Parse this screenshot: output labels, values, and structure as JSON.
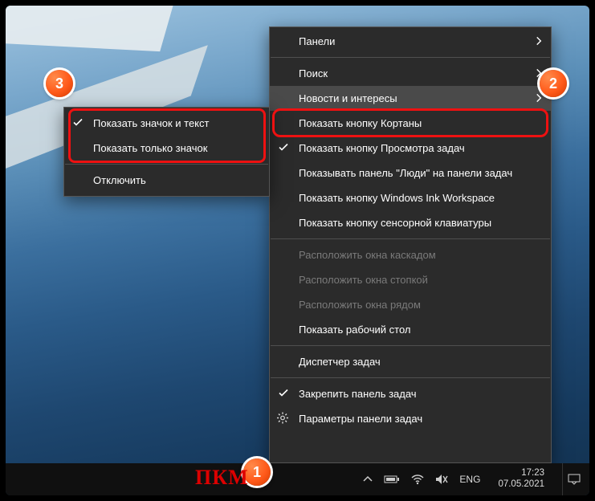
{
  "main_menu": {
    "panels": "Панели",
    "search": "Поиск",
    "news": "Новости и интересы",
    "cortana": "Показать кнопку Кортаны",
    "taskview": "Показать кнопку Просмотра задач",
    "people": "Показывать панель \"Люди\" на панели задач",
    "ink": "Показать кнопку Windows Ink Workspace",
    "touchkb": "Показать кнопку сенсорной клавиатуры",
    "cascade": "Расположить окна каскадом",
    "stack": "Расположить окна стопкой",
    "sidebyside": "Расположить окна рядом",
    "showdesktop": "Показать рабочий стол",
    "taskmgr": "Диспетчер задач",
    "lock": "Закрепить панель задач",
    "settings": "Параметры панели задач"
  },
  "sub_menu": {
    "icon_text": "Показать значок и текст",
    "icon_only": "Показать только значок",
    "off": "Отключить"
  },
  "taskbar": {
    "lang": "ENG",
    "time": "17:23",
    "date": "07.05.2021"
  },
  "annotations": {
    "pkm": "ПКМ",
    "b1": "1",
    "b2": "2",
    "b3": "3"
  }
}
